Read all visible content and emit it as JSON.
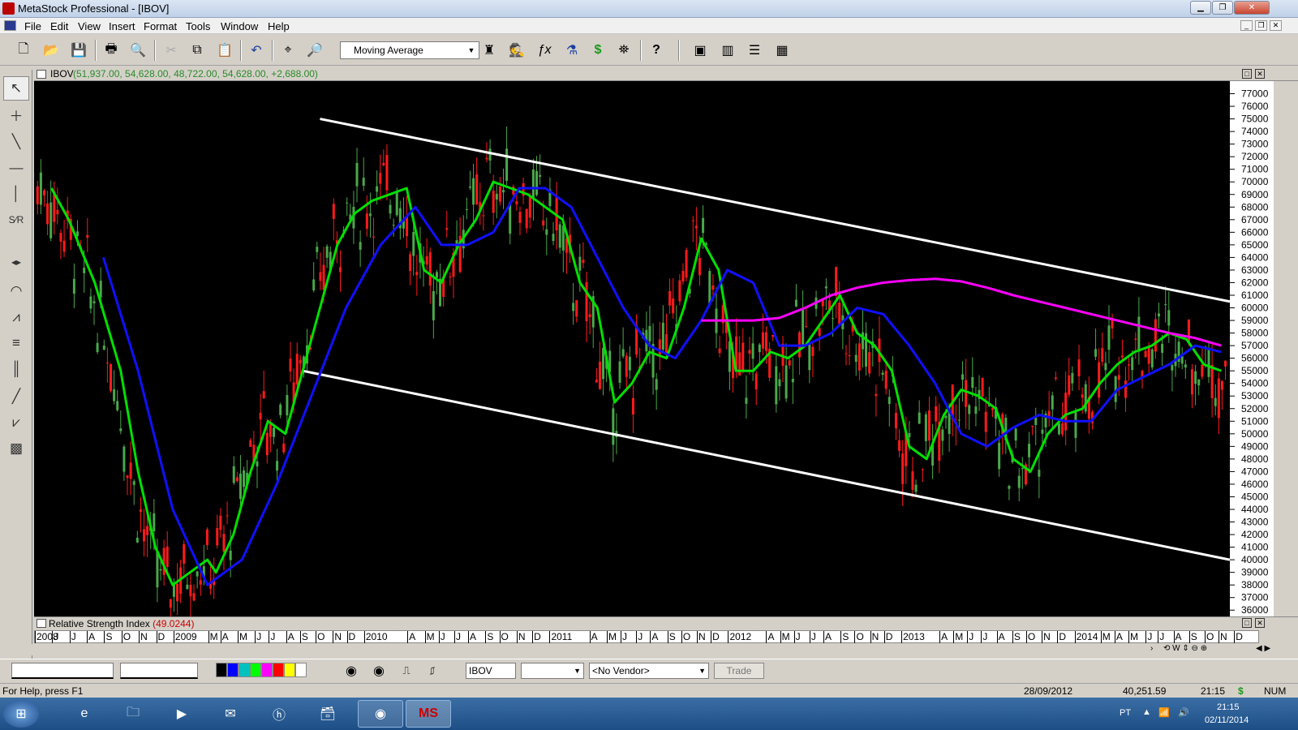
{
  "window": {
    "title": "MetaStock Professional - [IBOV]"
  },
  "menu": [
    "File",
    "Edit",
    "View",
    "Insert",
    "Format",
    "Tools",
    "Window",
    "Help"
  ],
  "toolbar": {
    "indicator_select": "Moving Average",
    "icons": [
      "new-icon",
      "open-icon",
      "save-icon",
      "print-icon",
      "print-preview-icon",
      "cut-icon",
      "copy-icon",
      "paste-icon",
      "undo-icon",
      "crosshair-icon",
      "zoom-icon",
      "trader-icon",
      "detective-icon",
      "formula-icon",
      "explorer-icon",
      "dollar-icon",
      "binoculars-icon",
      "help-icon",
      "tile-icon",
      "columns-icon",
      "rows-icon",
      "grid-icon"
    ]
  },
  "chart_header": {
    "symbol": "IBOV",
    "values": "(51,937.00, 54,628.00, 48,722.00, 54,628.00, +2,688.00)"
  },
  "chart_data": {
    "type": "line",
    "title": "IBOV",
    "ylim": [
      35500,
      78000
    ],
    "y_ticks": [
      36000,
      37000,
      38000,
      39000,
      40000,
      41000,
      42000,
      43000,
      44000,
      45000,
      46000,
      47000,
      48000,
      49000,
      50000,
      51000,
      52000,
      53000,
      54000,
      55000,
      56000,
      57000,
      58000,
      59000,
      60000,
      61000,
      62000,
      63000,
      64000,
      65000,
      66000,
      67000,
      68000,
      69000,
      70000,
      71000,
      72000,
      73000,
      74000,
      75000,
      76000,
      77000
    ],
    "x_range": [
      2008.0,
      2014.9
    ],
    "series": [
      {
        "color": "#00e000",
        "x": [
          2008.1,
          2008.2,
          2008.35,
          2008.5,
          2008.6,
          2008.7,
          2008.8,
          2008.9,
          2009.0,
          2009.05,
          2009.15,
          2009.25,
          2009.35,
          2009.45,
          2009.55,
          2009.65,
          2009.75,
          2009.85,
          2009.95,
          2010.05,
          2010.15,
          2010.25,
          2010.35,
          2010.45,
          2010.55,
          2010.65,
          2010.75,
          2010.85,
          2010.95,
          2011.05,
          2011.15,
          2011.25,
          2011.35,
          2011.45,
          2011.55,
          2011.65,
          2011.75,
          2011.85,
          2011.95,
          2012.05,
          2012.15,
          2012.25,
          2012.35,
          2012.45,
          2012.55,
          2012.65,
          2012.75,
          2012.85,
          2012.95,
          2013.05,
          2013.15,
          2013.25,
          2013.35,
          2013.45,
          2013.55,
          2013.65,
          2013.75,
          2013.85,
          2013.95,
          2014.05,
          2014.15,
          2014.25,
          2014.35,
          2014.45,
          2014.55,
          2014.65,
          2014.75,
          2014.85
        ],
        "values": [
          69500,
          67000,
          62000,
          55000,
          47000,
          41000,
          38000,
          39000,
          40000,
          39000,
          42000,
          47000,
          51000,
          50000,
          55000,
          60000,
          65000,
          67500,
          68500,
          69000,
          69500,
          63000,
          62000,
          65000,
          67000,
          70000,
          69500,
          69000,
          68000,
          67000,
          62000,
          60000,
          52500,
          54000,
          56500,
          56000,
          60000,
          65500,
          63000,
          55000,
          55000,
          56500,
          56000,
          57000,
          59000,
          61000,
          58000,
          57000,
          55000,
          49000,
          48000,
          51500,
          53500,
          53000,
          52000,
          48000,
          47000,
          50000,
          51500,
          52000,
          54000,
          55500,
          56500,
          57000,
          58000,
          57500,
          55500,
          55000
        ]
      },
      {
        "color": "#1010ff",
        "x": [
          2008.4,
          2008.6,
          2008.8,
          2009.0,
          2009.2,
          2009.4,
          2009.6,
          2009.8,
          2010.0,
          2010.2,
          2010.35,
          2010.5,
          2010.65,
          2010.8,
          2010.95,
          2011.1,
          2011.25,
          2011.4,
          2011.55,
          2011.7,
          2011.85,
          2012.0,
          2012.15,
          2012.3,
          2012.45,
          2012.6,
          2012.75,
          2012.9,
          2013.05,
          2013.2,
          2013.35,
          2013.5,
          2013.65,
          2013.8,
          2013.95,
          2014.1,
          2014.25,
          2014.4,
          2014.55,
          2014.7,
          2014.85
        ],
        "values": [
          64000,
          55000,
          44000,
          38000,
          40000,
          46000,
          53000,
          60000,
          65000,
          68000,
          65000,
          65000,
          66000,
          69500,
          69500,
          68000,
          64000,
          60000,
          57000,
          56000,
          59000,
          63000,
          62000,
          57000,
          57000,
          58000,
          60000,
          59500,
          57000,
          54000,
          50000,
          49000,
          50500,
          51500,
          51000,
          51000,
          53500,
          54500,
          55500,
          57000,
          56500
        ]
      },
      {
        "color": "#ff00ff",
        "x": [
          2011.85,
          2012.0,
          2012.15,
          2012.3,
          2012.45,
          2012.6,
          2012.75,
          2012.9,
          2013.05,
          2013.2,
          2013.35,
          2013.5,
          2013.65,
          2013.8,
          2013.95,
          2014.1,
          2014.25,
          2014.4,
          2014.55,
          2014.7,
          2014.85
        ],
        "values": [
          59000,
          59000,
          59000,
          59200,
          60000,
          61000,
          61600,
          62000,
          62200,
          62300,
          62100,
          61600,
          61000,
          60500,
          60000,
          59500,
          59000,
          58500,
          58000,
          57600,
          57000
        ]
      }
    ],
    "channel": [
      {
        "color": "#ffffff",
        "x": [
          2009.65,
          2014.9
        ],
        "values": [
          75000,
          60500
        ]
      },
      {
        "color": "#ffffff",
        "x": [
          2009.55,
          2014.9
        ],
        "values": [
          55000,
          40000
        ]
      }
    ]
  },
  "rsi": {
    "label": "Relative Strength Index",
    "value": "(49.0244)"
  },
  "x_axis": [
    {
      "label": "2008",
      "pos": 2008.0
    },
    {
      "label": "J",
      "pos": 2008.1
    },
    {
      "label": "J",
      "pos": 2008.2
    },
    {
      "label": "A",
      "pos": 2008.3
    },
    {
      "label": "S",
      "pos": 2008.4
    },
    {
      "label": "O",
      "pos": 2008.5
    },
    {
      "label": "N",
      "pos": 2008.6
    },
    {
      "label": "D",
      "pos": 2008.7
    },
    {
      "label": "2009",
      "pos": 2008.8
    },
    {
      "label": "M",
      "pos": 2009.0
    },
    {
      "label": "A",
      "pos": 2009.07
    },
    {
      "label": "M",
      "pos": 2009.17
    },
    {
      "label": "J",
      "pos": 2009.27
    },
    {
      "label": "J",
      "pos": 2009.35
    },
    {
      "label": "A",
      "pos": 2009.45
    },
    {
      "label": "S",
      "pos": 2009.53
    },
    {
      "label": "O",
      "pos": 2009.62
    },
    {
      "label": "N",
      "pos": 2009.72
    },
    {
      "label": "D",
      "pos": 2009.8
    },
    {
      "label": "2010",
      "pos": 2009.9
    },
    {
      "label": "A",
      "pos": 2010.15
    },
    {
      "label": "M",
      "pos": 2010.25
    },
    {
      "label": "J",
      "pos": 2010.33
    },
    {
      "label": "J",
      "pos": 2010.42
    },
    {
      "label": "A",
      "pos": 2010.5
    },
    {
      "label": "S",
      "pos": 2010.6
    },
    {
      "label": "O",
      "pos": 2010.68
    },
    {
      "label": "N",
      "pos": 2010.78
    },
    {
      "label": "D",
      "pos": 2010.87
    },
    {
      "label": "2011",
      "pos": 2010.97
    },
    {
      "label": "A",
      "pos": 2011.2
    },
    {
      "label": "M",
      "pos": 2011.3
    },
    {
      "label": "J",
      "pos": 2011.38
    },
    {
      "label": "J",
      "pos": 2011.47
    },
    {
      "label": "A",
      "pos": 2011.55
    },
    {
      "label": "S",
      "pos": 2011.65
    },
    {
      "label": "O",
      "pos": 2011.73
    },
    {
      "label": "N",
      "pos": 2011.82
    },
    {
      "label": "D",
      "pos": 2011.9
    },
    {
      "label": "2012",
      "pos": 2012.0
    },
    {
      "label": "A",
      "pos": 2012.22
    },
    {
      "label": "M",
      "pos": 2012.3
    },
    {
      "label": "J",
      "pos": 2012.38
    },
    {
      "label": "J",
      "pos": 2012.47
    },
    {
      "label": "A",
      "pos": 2012.55
    },
    {
      "label": "S",
      "pos": 2012.65
    },
    {
      "label": "O",
      "pos": 2012.73
    },
    {
      "label": "N",
      "pos": 2012.82
    },
    {
      "label": "D",
      "pos": 2012.9
    },
    {
      "label": "2013",
      "pos": 2013.0
    },
    {
      "label": "A",
      "pos": 2013.22
    },
    {
      "label": "M",
      "pos": 2013.3
    },
    {
      "label": "J",
      "pos": 2013.38
    },
    {
      "label": "J",
      "pos": 2013.46
    },
    {
      "label": "A",
      "pos": 2013.55
    },
    {
      "label": "S",
      "pos": 2013.64
    },
    {
      "label": "O",
      "pos": 2013.72
    },
    {
      "label": "N",
      "pos": 2013.81
    },
    {
      "label": "D",
      "pos": 2013.9
    },
    {
      "label": "2014",
      "pos": 2014.0
    },
    {
      "label": "M",
      "pos": 2014.15
    },
    {
      "label": "A",
      "pos": 2014.23
    },
    {
      "label": "M",
      "pos": 2014.31
    },
    {
      "label": "J",
      "pos": 2014.41
    },
    {
      "label": "J",
      "pos": 2014.48
    },
    {
      "label": "A",
      "pos": 2014.57
    },
    {
      "label": "S",
      "pos": 2014.66
    },
    {
      "label": "O",
      "pos": 2014.75
    },
    {
      "label": "N",
      "pos": 2014.83
    },
    {
      "label": "D",
      "pos": 2014.92
    }
  ],
  "bottombar": {
    "symbol": "IBOV",
    "vendor": "<No Vendor>",
    "trade_label": "Trade"
  },
  "status": {
    "help": "For Help, press F1",
    "date": "28/09/2012",
    "value": "40,251.59",
    "time": "21:15",
    "dollar": "$",
    "num": "NUM"
  },
  "taskbar": {
    "lang": "PT",
    "time": "21:15",
    "date": "02/11/2014"
  },
  "colors": {
    "bg": "#000000",
    "up": "#4aa84a",
    "down": "#ff1a1a"
  }
}
